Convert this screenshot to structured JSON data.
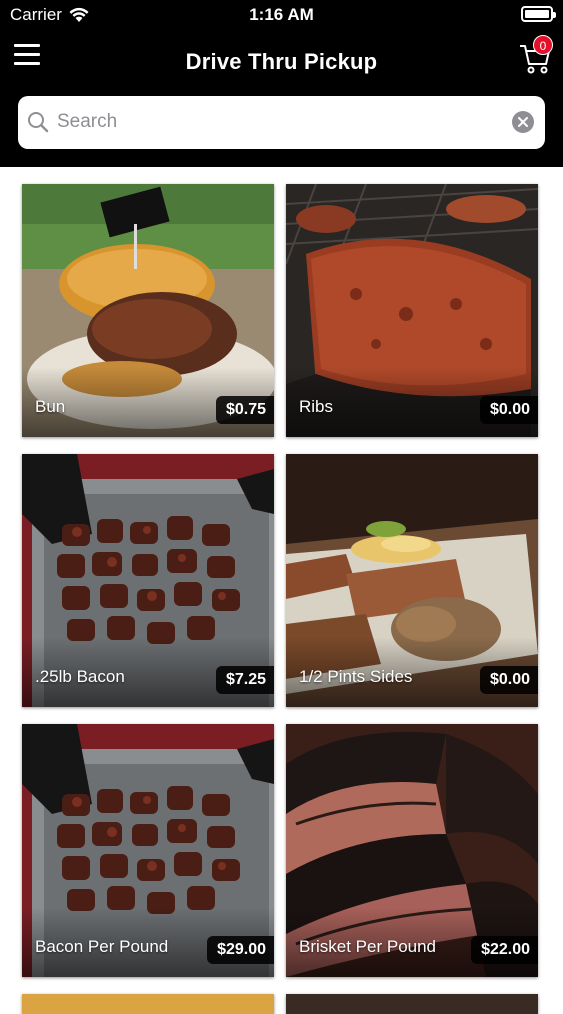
{
  "status_bar": {
    "carrier": "Carrier",
    "time": "1:16 AM"
  },
  "header": {
    "title": "Drive Thru Pickup",
    "cart_count": "0"
  },
  "search": {
    "placeholder": "Search",
    "value": ""
  },
  "colors": {
    "header_bg": "#000000",
    "badge": "#e4102a",
    "price_bg": "#000000"
  },
  "items": [
    {
      "name": "Bun",
      "price": "$0.75",
      "image": "pulled-pork-sandwich"
    },
    {
      "name": "Ribs",
      "price": "$0.00",
      "image": "ribs-on-grill"
    },
    {
      "name": ".25lb Bacon",
      "price": "$7.25",
      "image": "bacon-burnt-ends"
    },
    {
      "name": "1/2 Pints Sides",
      "price": "$0.00",
      "image": "bbq-plate-with-sides"
    },
    {
      "name": "Bacon Per Pound",
      "price": "$29.00",
      "image": "bacon-burnt-ends"
    },
    {
      "name": "Brisket Per Pound",
      "price": "$22.00",
      "image": "sliced-brisket"
    }
  ]
}
